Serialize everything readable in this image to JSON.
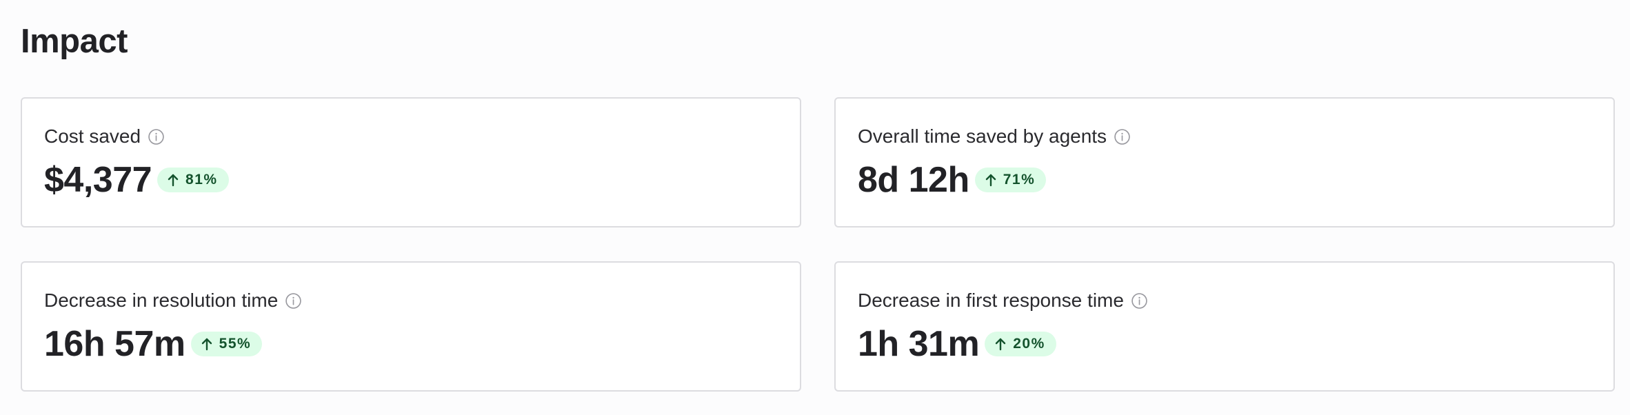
{
  "section": {
    "title": "Impact"
  },
  "colors": {
    "badge_background": "#dcfce7",
    "badge_text": "#14532d",
    "card_border": "#dcdce0",
    "info_icon": "#9a9aa0"
  },
  "icons": {
    "info": "info-icon",
    "change": "arrow-up-icon"
  },
  "cards": [
    {
      "label": "Cost saved",
      "value": "$4,377",
      "change": "81%"
    },
    {
      "label": "Overall time saved by agents",
      "value": "8d 12h",
      "change": "71%"
    },
    {
      "label": "Decrease in resolution time",
      "value": "16h 57m",
      "change": "55%"
    },
    {
      "label": "Decrease in first response time",
      "value": "1h 31m",
      "change": "20%"
    }
  ]
}
